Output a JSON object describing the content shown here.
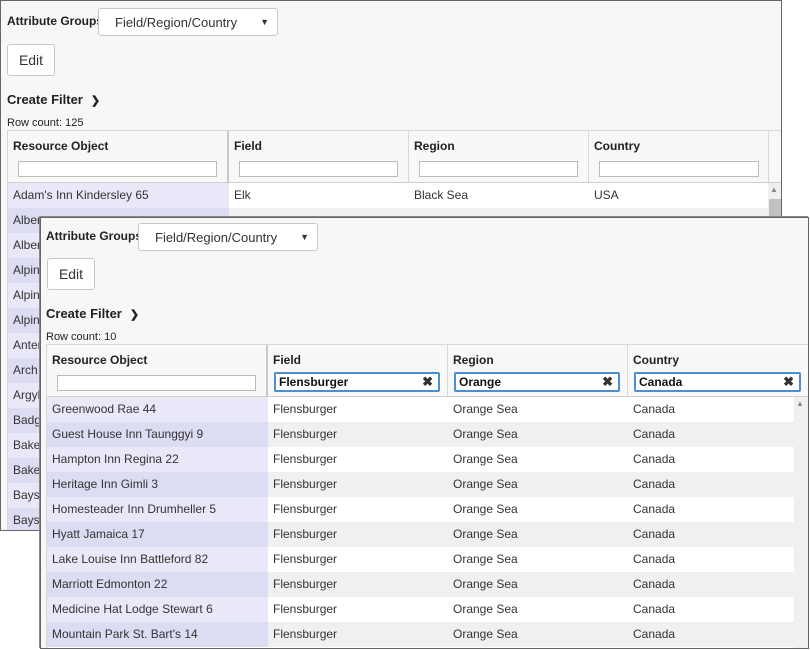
{
  "back": {
    "attr_label": "Attribute Groups:",
    "select_value": "Field/Region/Country",
    "edit_label": "Edit",
    "create_filter": "Create Filter",
    "row_count": "Row count: 125",
    "columns": [
      "Resource Object",
      "Field",
      "Region",
      "Country"
    ],
    "rows": [
      [
        "Adam's Inn Kindersley 65",
        "Elk",
        "Black Sea",
        "USA"
      ],
      [
        "Albert",
        "",
        "",
        ""
      ],
      [
        "Albert",
        "",
        "",
        ""
      ],
      [
        "Alpine",
        "",
        "",
        ""
      ],
      [
        "Alpine",
        "",
        "",
        ""
      ],
      [
        "Alpine",
        "",
        "",
        ""
      ],
      [
        "Anteri",
        "",
        "",
        ""
      ],
      [
        "Arch R",
        "",
        "",
        ""
      ],
      [
        "Argyll",
        "",
        "",
        ""
      ],
      [
        "Badge",
        "",
        "",
        ""
      ],
      [
        "Baker",
        "",
        "",
        ""
      ],
      [
        "Baker",
        "",
        "",
        ""
      ],
      [
        "Baysh",
        "",
        "",
        ""
      ],
      [
        "Baysh",
        "",
        "",
        ""
      ]
    ]
  },
  "front": {
    "attr_label": "Attribute Groups:",
    "select_value": "Field/Region/Country",
    "edit_label": "Edit",
    "create_filter": "Create Filter",
    "row_count": "Row count: 10",
    "columns": [
      "Resource Object",
      "Field",
      "Region",
      "Country"
    ],
    "filters": [
      "",
      "Flensburger",
      "Orange",
      "Canada"
    ],
    "rows": [
      [
        "Greenwood Rae 44",
        "Flensburger",
        "Orange Sea",
        "Canada"
      ],
      [
        "Guest House Inn Taunggyi 9",
        "Flensburger",
        "Orange Sea",
        "Canada"
      ],
      [
        "Hampton Inn Regina 22",
        "Flensburger",
        "Orange Sea",
        "Canada"
      ],
      [
        "Heritage Inn Gimli 3",
        "Flensburger",
        "Orange Sea",
        "Canada"
      ],
      [
        "Homesteader Inn Drumheller 5",
        "Flensburger",
        "Orange Sea",
        "Canada"
      ],
      [
        "Hyatt Jamaica 17",
        "Flensburger",
        "Orange Sea",
        "Canada"
      ],
      [
        "Lake Louise Inn Battleford 82",
        "Flensburger",
        "Orange Sea",
        "Canada"
      ],
      [
        "Marriott Edmonton 22",
        "Flensburger",
        "Orange Sea",
        "Canada"
      ],
      [
        "Medicine Hat Lodge Stewart 6",
        "Flensburger",
        "Orange Sea",
        "Canada"
      ],
      [
        "Mountain Park St. Bart's 14",
        "Flensburger",
        "Orange Sea",
        "Canada"
      ]
    ]
  }
}
